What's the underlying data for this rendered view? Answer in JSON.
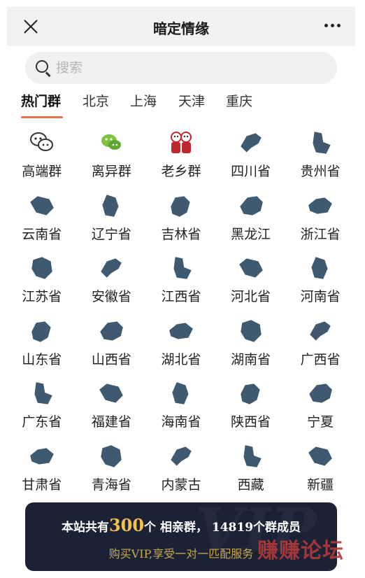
{
  "header": {
    "title": "暗定情缘"
  },
  "search": {
    "placeholder": "搜索"
  },
  "tabs": [
    {
      "label": "热门群",
      "active": true
    },
    {
      "label": "北京"
    },
    {
      "label": "上海"
    },
    {
      "label": "天津"
    },
    {
      "label": "重庆"
    }
  ],
  "groups": [
    {
      "label": "高端群",
      "icon": "chat-bubbles-icon"
    },
    {
      "label": "离异群",
      "icon": "wechat-icon"
    },
    {
      "label": "老乡群",
      "icon": "couple-icon"
    },
    {
      "label": "四川省",
      "icon": "province-map-icon"
    },
    {
      "label": "贵州省",
      "icon": "province-map-icon"
    },
    {
      "label": "云南省",
      "icon": "province-map-icon"
    },
    {
      "label": "辽宁省",
      "icon": "province-map-icon"
    },
    {
      "label": "吉林省",
      "icon": "province-map-icon"
    },
    {
      "label": "黑龙江",
      "icon": "province-map-icon"
    },
    {
      "label": "浙江省",
      "icon": "province-map-icon"
    },
    {
      "label": "江苏省",
      "icon": "province-map-icon"
    },
    {
      "label": "安徽省",
      "icon": "province-map-icon"
    },
    {
      "label": "江西省",
      "icon": "province-map-icon"
    },
    {
      "label": "河北省",
      "icon": "province-map-icon"
    },
    {
      "label": "河南省",
      "icon": "province-map-icon"
    },
    {
      "label": "山东省",
      "icon": "province-map-icon"
    },
    {
      "label": "山西省",
      "icon": "province-map-icon"
    },
    {
      "label": "湖北省",
      "icon": "province-map-icon"
    },
    {
      "label": "湖南省",
      "icon": "province-map-icon"
    },
    {
      "label": "广西省",
      "icon": "province-map-icon"
    },
    {
      "label": "广东省",
      "icon": "province-map-icon"
    },
    {
      "label": "福建省",
      "icon": "province-map-icon"
    },
    {
      "label": "海南省",
      "icon": "province-map-icon"
    },
    {
      "label": "陕西省",
      "icon": "province-map-icon"
    },
    {
      "label": "宁夏",
      "icon": "province-map-icon"
    },
    {
      "label": "甘肃省",
      "icon": "province-map-icon"
    },
    {
      "label": "青海省",
      "icon": "province-map-icon"
    },
    {
      "label": "内蒙古",
      "icon": "province-map-icon"
    },
    {
      "label": "西藏",
      "icon": "province-map-icon"
    },
    {
      "label": "新疆",
      "icon": "province-map-icon"
    }
  ],
  "banner": {
    "line1_prefix": "本站共有",
    "group_count": "300",
    "line1_suffix": "个 相亲群，",
    "member_count": "14819",
    "line1_tail": "个群成员",
    "line2": "购买VIP,享受一对一匹配服务",
    "watermark": "VIP"
  },
  "overlay": {
    "text": "赚赚论坛"
  },
  "colors": {
    "accent": "#e8734f",
    "map": "#3f5a70",
    "banner_bg": "#1c2235",
    "gold": "#f2c14e"
  }
}
